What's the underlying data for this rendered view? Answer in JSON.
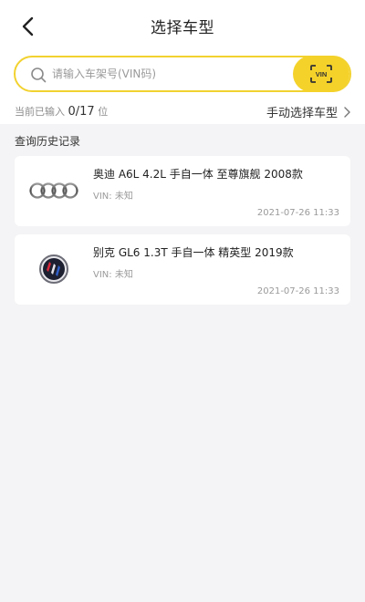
{
  "header": {
    "title": "选择车型"
  },
  "search": {
    "placeholder": "请输入车架号(VIN码)",
    "value": "",
    "scan_label": "VIN"
  },
  "status": {
    "prefix": "当前已输入",
    "count": "0/17",
    "suffix": "位",
    "manual_label": "手动选择车型"
  },
  "history": {
    "heading": "查询历史记录",
    "items": [
      {
        "brand_icon": "audi-logo-icon",
        "title": "奥迪 A6L 4.2L 手自一体 至尊旗舰 2008款",
        "vin": "VIN: 未知",
        "date": "2021-07-26 11:33"
      },
      {
        "brand_icon": "buick-logo-icon",
        "title": "别克 GL6 1.3T 手自一体 精英型 2019款",
        "vin": "VIN: 未知",
        "date": "2021-07-26 11:33"
      }
    ]
  },
  "colors": {
    "accent": "#f4d22a",
    "search_border": "#f2d230",
    "background": "#f4f4f6"
  }
}
